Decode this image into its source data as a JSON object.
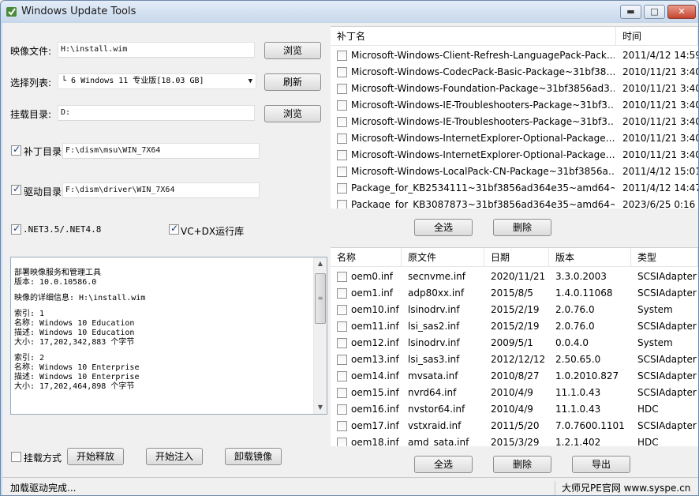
{
  "window": {
    "title": "Windows Update Tools",
    "minimize": "▬",
    "maximize": "□",
    "close": "✕"
  },
  "form": {
    "image_label": "映像文件:",
    "image_value": "H:\\install.wim",
    "browse_label": "浏览",
    "list_label": "选择列表:",
    "list_value": "└ 6 Windows 11 专业版[18.03 GB]",
    "refresh_label": "刷新",
    "mount_label": "挂载目录:",
    "mount_value": "D:",
    "browse2_label": "浏览",
    "patch_dir_label": "补丁目录",
    "patch_dir_value": "F:\\dism\\msu\\WIN_7X64",
    "driver_dir_label": "驱动目录",
    "driver_dir_value": "F:\\dism\\driver\\WIN_7X64",
    "net_label": ".NET3.5/.NET4.8",
    "vc_label": "VC+DX运行库"
  },
  "log": {
    "lines": [
      "部署映像服务和管理工具",
      "版本: 10.0.10586.0",
      "",
      "映像的详细信息: H:\\install.wim",
      "",
      "索引: 1",
      "名称: Windows 10 Education",
      "描述: Windows 10 Education",
      "大小: 17,202,342,883 个字节",
      "",
      "索引: 2",
      "名称: Windows 10 Enterprise",
      "描述: Windows 10 Enterprise",
      "大小: 17,202,464,898 个字节"
    ]
  },
  "bottom_controls": {
    "mount_mode_label": "挂载方式",
    "start_release": "开始释放",
    "start_inject": "开始注入",
    "unmount": "卸载镜像"
  },
  "patch_list": {
    "columns": [
      "补丁名",
      "时间"
    ],
    "rows": [
      [
        "Microsoft-Windows-Client-Refresh-LanguagePack-Pack…",
        "2011/4/12 14:59"
      ],
      [
        "Microsoft-Windows-CodecPack-Basic-Package~31bf38…",
        "2010/11/21 3:40"
      ],
      [
        "Microsoft-Windows-Foundation-Package~31bf3856ad3…",
        "2010/11/21 3:40"
      ],
      [
        "Microsoft-Windows-IE-Troubleshooters-Package~31bf3…",
        "2010/11/21 3:40"
      ],
      [
        "Microsoft-Windows-IE-Troubleshooters-Package~31bf3…",
        "2010/11/21 3:40"
      ],
      [
        "Microsoft-Windows-InternetExplorer-Optional-Package…",
        "2010/11/21 3:40"
      ],
      [
        "Microsoft-Windows-InternetExplorer-Optional-Package…",
        "2010/11/21 3:40"
      ],
      [
        "Microsoft-Windows-LocalPack-CN-Package~31bf3856a…",
        "2011/4/12 15:01"
      ],
      [
        "Package_for_KB2534111~31bf3856ad364e35~amd64~…",
        "2011/4/12 14:47"
      ],
      [
        "Package_for_KB3087873~31bf3856ad364e35~amd64~…",
        "2023/6/25 0:16"
      ]
    ],
    "select_all": "全选",
    "delete": "删除"
  },
  "driver_list": {
    "columns": [
      "名称",
      "原文件",
      "日期",
      "版本",
      "类型"
    ],
    "rows": [
      [
        "oem0.inf",
        "secnvme.inf",
        "2020/11/21",
        "3.3.0.2003",
        "SCSIAdapter"
      ],
      [
        "oem1.inf",
        "adp80xx.inf",
        "2015/8/5",
        "1.4.0.11068",
        "SCSIAdapter"
      ],
      [
        "oem10.inf",
        "lsinodrv.inf",
        "2015/2/19",
        "2.0.76.0",
        "System"
      ],
      [
        "oem11.inf",
        "lsi_sas2.inf",
        "2015/2/19",
        "2.0.76.0",
        "SCSIAdapter"
      ],
      [
        "oem12.inf",
        "lsinodrv.inf",
        "2009/5/1",
        "0.0.4.0",
        "System"
      ],
      [
        "oem13.inf",
        "lsi_sas3.inf",
        "2012/12/12",
        "2.50.65.0",
        "SCSIAdapter"
      ],
      [
        "oem14.inf",
        "mvsata.inf",
        "2010/8/27",
        "1.0.2010.827",
        "SCSIAdapter"
      ],
      [
        "oem15.inf",
        "nvrd64.inf",
        "2010/4/9",
        "11.1.0.43",
        "SCSIAdapter"
      ],
      [
        "oem16.inf",
        "nvstor64.inf",
        "2010/4/9",
        "11.1.0.43",
        "HDC"
      ],
      [
        "oem17.inf",
        "vstxraid.inf",
        "2011/5/20",
        "7.0.7600.1101",
        "SCSIAdapter"
      ],
      [
        "oem18.inf",
        "amd_sata.inf",
        "2015/3/29",
        "1.2.1.402",
        "HDC"
      ]
    ],
    "select_all": "全选",
    "delete": "删除",
    "export": "导出"
  },
  "status": {
    "left": "加载驱动完成...",
    "right": "大师兄PE官网 www.syspe.cn"
  }
}
